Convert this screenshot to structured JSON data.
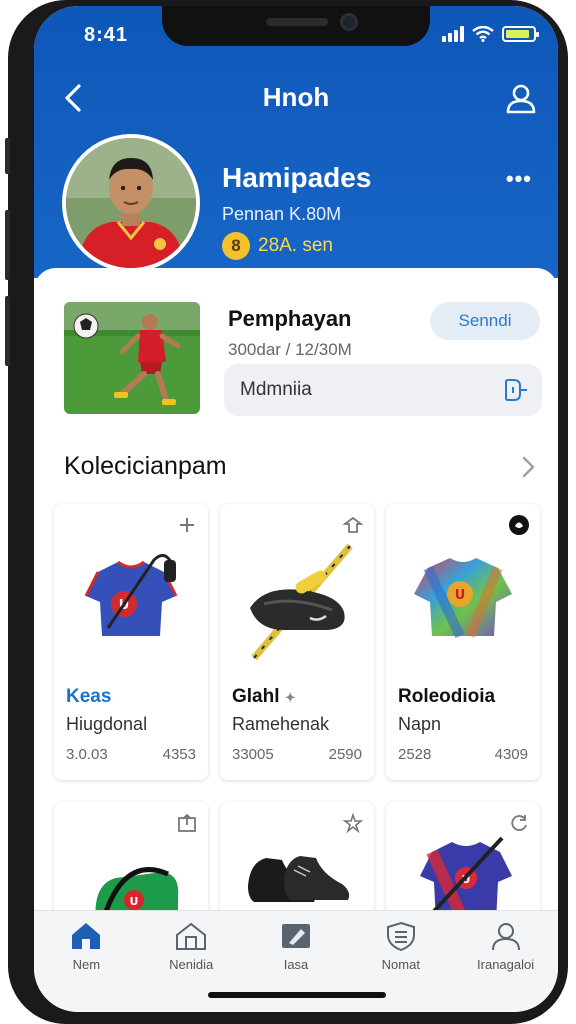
{
  "status": {
    "time": "8:41"
  },
  "nav": {
    "title": "Hnoh"
  },
  "profile": {
    "name": "Hamipades",
    "meta": "Pennan K.80M",
    "coin_symbol": "8",
    "coins": "28A. sen"
  },
  "feature": {
    "title": "Pemphayan",
    "subtitle": "300dar / 12/30M",
    "button_label": "Senndi",
    "message_placeholder": "Mdmniia"
  },
  "collection": {
    "title": "Kolecicianpam",
    "items": [
      {
        "title": "Keas",
        "subtitle": "Hiugdonal",
        "left": "3.0.03",
        "right": "4353",
        "title_color": "#1a73c9",
        "corner_icon": "plus-icon",
        "image_icon": "jersey-blue-icon"
      },
      {
        "title": "Glahl",
        "title_suffix": "✦",
        "subtitle": "Ramehenak",
        "left": "33005",
        "right": "2590",
        "title_color": "#111111",
        "corner_icon": "share-icon",
        "image_icon": "cleat-bat-icon"
      },
      {
        "title": "Roleodioia",
        "subtitle": "Napn",
        "left": "2528",
        "right": "4309",
        "title_color": "#111111",
        "corner_icon": "badge-icon",
        "image_icon": "jersey-rainbow-icon"
      }
    ],
    "row2": [
      {
        "corner_icon": "export-icon",
        "image_icon": "kit-bag-icon"
      },
      {
        "corner_icon": "star-plus-icon",
        "image_icon": "boots-icon"
      },
      {
        "corner_icon": "refresh-icon",
        "image_icon": "jersey-bat-icon"
      }
    ]
  },
  "tabs": [
    {
      "label": "Nem",
      "icon": "home-icon",
      "active": true
    },
    {
      "label": "Nenidia",
      "icon": "store-icon",
      "active": false
    },
    {
      "label": "Iasa",
      "icon": "media-icon",
      "active": false
    },
    {
      "label": "Nomat",
      "icon": "shield-icon",
      "active": false
    },
    {
      "label": "Iranagaloi",
      "icon": "profile-icon",
      "active": false
    }
  ],
  "colors": {
    "primary": "#0e57b8",
    "accent_blue": "#2a7bd0",
    "coin": "#f6c22b"
  }
}
